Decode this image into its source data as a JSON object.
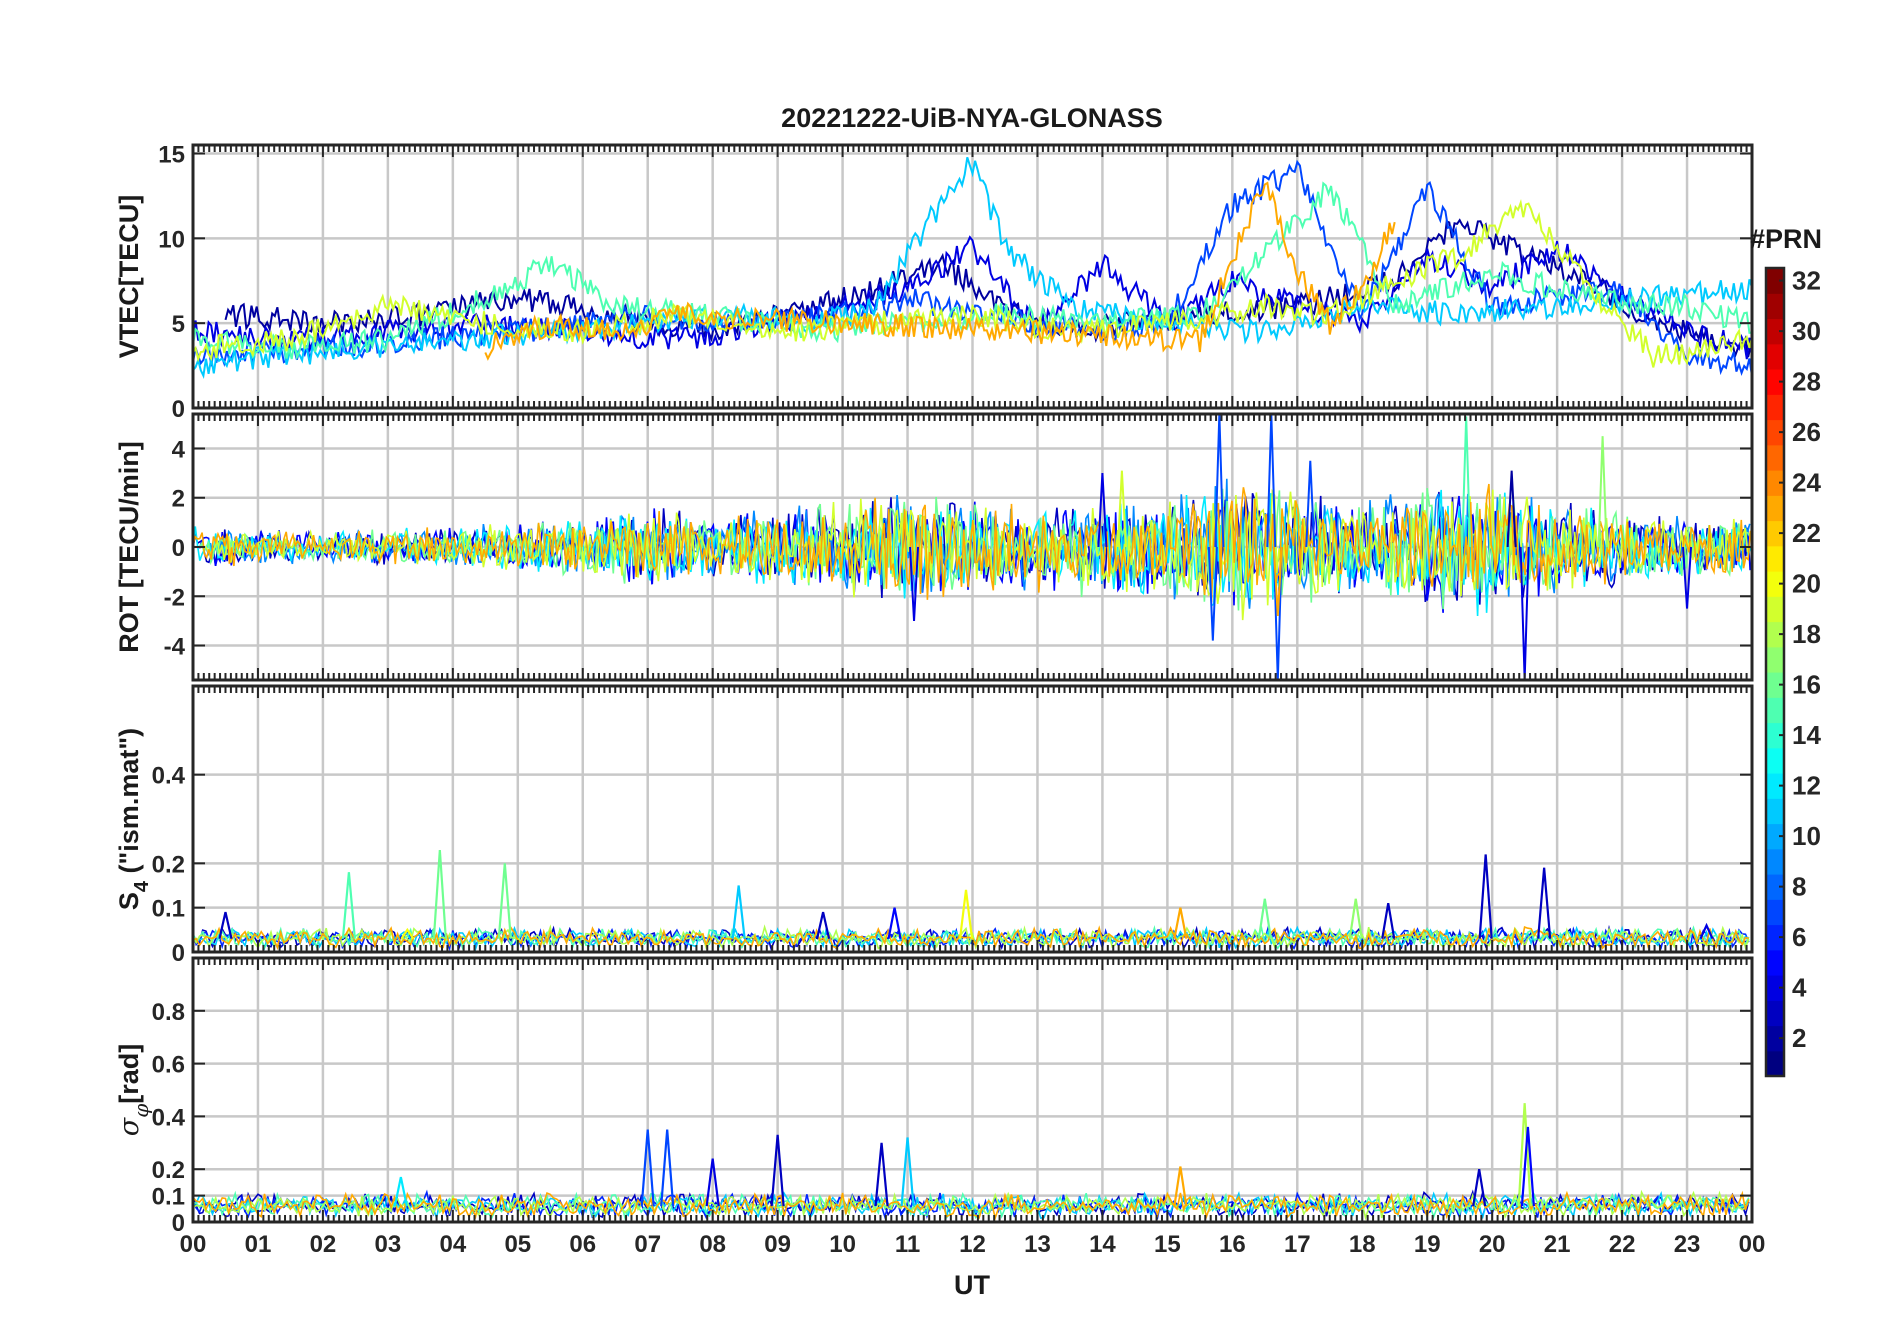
{
  "chart_data": {
    "type": "line",
    "title": "20221222-UiB-NYA-GLONASS",
    "xlabel": "UT",
    "x_range_hours": [
      0,
      24
    ],
    "x_tick_labels": [
      "00",
      "01",
      "02",
      "03",
      "04",
      "05",
      "06",
      "07",
      "08",
      "09",
      "10",
      "11",
      "12",
      "13",
      "14",
      "15",
      "16",
      "17",
      "18",
      "19",
      "20",
      "21",
      "22",
      "23",
      "00"
    ],
    "grid": true,
    "colorbar": {
      "title": "#PRN",
      "range": [
        1,
        32
      ],
      "tick_labels": [
        "2",
        "4",
        "6",
        "8",
        "10",
        "12",
        "14",
        "16",
        "18",
        "20",
        "22",
        "24",
        "26",
        "28",
        "30",
        "32"
      ],
      "colormap": "jet"
    },
    "panels": [
      {
        "id": "vtec",
        "ylabel": "VTEC[TECU]",
        "ylim": [
          0,
          15.5
        ],
        "y_ticks": [
          0,
          5,
          10,
          15
        ],
        "y_tick_labels": [
          "0",
          "5",
          "10",
          "15"
        ],
        "series": [
          {
            "prn": 2,
            "x": [
              0.5,
              2,
              3.5,
              5,
              6.5,
              8,
              9.5,
              10.5,
              11.5,
              12.5,
              13.5,
              14.5,
              15.5,
              17,
              18.5,
              19.5,
              20.5,
              21.5,
              22.5,
              24
            ],
            "values": [
              5.5,
              5.0,
              5.5,
              6.5,
              5.5,
              4.5,
              6.0,
              7.0,
              8.5,
              6.0,
              4.5,
              5.0,
              5.5,
              6.0,
              7.5,
              11.0,
              9.0,
              7.5,
              5.0,
              3.5
            ]
          },
          {
            "prn": 4,
            "x": [
              0,
              1.5,
              3,
              4.5,
              6,
              7.5,
              9,
              10,
              11,
              12,
              13,
              14,
              15,
              16,
              17,
              18,
              19,
              20,
              21,
              22,
              23,
              24
            ],
            "values": [
              4.5,
              4.0,
              4.5,
              5.0,
              4.5,
              4.0,
              5.0,
              6.0,
              7.0,
              9.5,
              4.5,
              8.5,
              5.0,
              7.5,
              6.0,
              5.0,
              9.0,
              7.0,
              9.5,
              6.5,
              4.5,
              3.5
            ]
          },
          {
            "prn": 7,
            "x": [
              0,
              2,
              3.5,
              5,
              6,
              7,
              8.5,
              10,
              11,
              12,
              13,
              14,
              15,
              16,
              17,
              18,
              19,
              20,
              21,
              22,
              23,
              24
            ],
            "values": [
              3.0,
              3.5,
              4.0,
              4.5,
              5.0,
              5.5,
              5.0,
              5.5,
              6.5,
              5.5,
              5.0,
              4.5,
              5.0,
              12.0,
              14.0,
              5.5,
              13.0,
              6.0,
              6.5,
              7.0,
              3.0,
              2.5
            ]
          },
          {
            "prn": 11,
            "x": [
              0,
              1,
              2.5,
              4,
              5.5,
              7,
              8.5,
              9.5,
              10.5,
              11.5,
              12,
              12.5,
              13.5,
              15,
              16.5,
              18,
              19.5,
              21,
              22.5,
              24
            ],
            "values": [
              2.5,
              3.0,
              3.5,
              4.0,
              4.5,
              5.0,
              5.5,
              5.0,
              6.0,
              12.0,
              14.5,
              9.5,
              6.0,
              5.0,
              4.5,
              6.0,
              5.5,
              6.0,
              6.5,
              7.0
            ]
          },
          {
            "prn": 15,
            "x": [
              0,
              1.5,
              3,
              4.5,
              5.5,
              6.5,
              8,
              9.5,
              11,
              12.5,
              14,
              15.5,
              16.5,
              17.5,
              18.5,
              20,
              21.5,
              23,
              24
            ],
            "values": [
              4.0,
              3.5,
              4.0,
              6.5,
              8.5,
              6.0,
              5.5,
              4.5,
              5.0,
              5.5,
              5.0,
              5.5,
              9.0,
              13.0,
              6.0,
              8.0,
              6.5,
              6.0,
              5.0
            ]
          },
          {
            "prn": 19,
            "x": [
              0,
              1.5,
              3,
              4.5,
              6,
              7.5,
              9,
              10.5,
              12,
              13.5,
              15,
              16.5,
              17.5,
              18.5,
              19.5,
              20.5,
              21.5,
              22.5,
              24
            ],
            "values": [
              3.5,
              4.0,
              6.0,
              5.0,
              4.5,
              5.5,
              4.5,
              5.0,
              5.5,
              4.5,
              5.0,
              6.0,
              5.5,
              7.5,
              9.0,
              12.0,
              7.0,
              3.0,
              4.0
            ]
          },
          {
            "prn": 23,
            "x": [
              4.5,
              5.5,
              6.5,
              7.5,
              15.5,
              16.5,
              17,
              17.5,
              18,
              18.5
            ],
            "values": [
              3.5,
              5.0,
              4.5,
              5.5,
              4.0,
              13.5,
              8.0,
              5.0,
              7.0,
              11.0
            ]
          }
        ]
      },
      {
        "id": "rot",
        "ylabel": "ROT [TECU/min]",
        "ylim": [
          -5.4,
          5.4
        ],
        "y_ticks": [
          -4,
          -2,
          0,
          2,
          4
        ],
        "y_tick_labels": [
          "-4",
          "-2",
          "0",
          "2",
          "4"
        ],
        "envelope": {
          "x": [
            0,
            1,
            2,
            3,
            4,
            5,
            6,
            7,
            8,
            9,
            10,
            11,
            12,
            13,
            14,
            15,
            16,
            17,
            18,
            19,
            20,
            21,
            22,
            23,
            24
          ],
          "values": [
            0.8,
            0.7,
            0.6,
            0.7,
            0.8,
            1.0,
            1.2,
            1.6,
            1.3,
            1.5,
            1.8,
            2.2,
            1.8,
            1.7,
            2.0,
            2.0,
            3.0,
            2.2,
            1.8,
            2.5,
            2.6,
            2.0,
            1.4,
            1.2,
            1.2
          ]
        },
        "spikes": [
          {
            "x": 11.1,
            "value": -3.0,
            "prn": 4
          },
          {
            "x": 14.0,
            "value": 3.0,
            "prn": 4
          },
          {
            "x": 14.3,
            "value": 3.1,
            "prn": 19
          },
          {
            "x": 15.8,
            "value": 5.4,
            "prn": 7
          },
          {
            "x": 15.7,
            "value": -3.8,
            "prn": 7
          },
          {
            "x": 16.6,
            "value": 5.4,
            "prn": 7
          },
          {
            "x": 16.7,
            "value": -5.4,
            "prn": 7
          },
          {
            "x": 17.2,
            "value": 3.5,
            "prn": 7
          },
          {
            "x": 19.6,
            "value": 5.3,
            "prn": 15
          },
          {
            "x": 20.3,
            "value": 3.1,
            "prn": 2
          },
          {
            "x": 20.5,
            "value": -5.4,
            "prn": 4
          },
          {
            "x": 21.7,
            "value": 4.5,
            "prn": 17
          },
          {
            "x": 23.0,
            "value": -2.5,
            "prn": 4
          },
          {
            "x": 16.7,
            "value": -2.8,
            "prn": 23
          }
        ]
      },
      {
        "id": "s4",
        "ylabel": "S4 (\"ism.mat\")",
        "ylim": [
          0,
          0.6
        ],
        "y_ticks": [
          0,
          0.1,
          0.2,
          0.4
        ],
        "y_tick_labels": [
          "0",
          "0.1",
          "0.2",
          "0.4"
        ],
        "baseline": 0.03,
        "spikes": [
          {
            "x": 0.5,
            "value": 0.09,
            "prn": 3
          },
          {
            "x": 2.4,
            "value": 0.18,
            "prn": 15
          },
          {
            "x": 3.3,
            "value": 0.05,
            "prn": 20
          },
          {
            "x": 3.8,
            "value": 0.23,
            "prn": 16
          },
          {
            "x": 4.8,
            "value": 0.2,
            "prn": 16
          },
          {
            "x": 8.4,
            "value": 0.15,
            "prn": 11
          },
          {
            "x": 9.7,
            "value": 0.09,
            "prn": 3
          },
          {
            "x": 10.8,
            "value": 0.1,
            "prn": 5
          },
          {
            "x": 11.9,
            "value": 0.14,
            "prn": 20
          },
          {
            "x": 15.2,
            "value": 0.1,
            "prn": 23
          },
          {
            "x": 16.5,
            "value": 0.12,
            "prn": 16
          },
          {
            "x": 17.9,
            "value": 0.12,
            "prn": 17
          },
          {
            "x": 18.4,
            "value": 0.11,
            "prn": 3
          },
          {
            "x": 19.9,
            "value": 0.22,
            "prn": 3
          },
          {
            "x": 20.8,
            "value": 0.19,
            "prn": 3
          },
          {
            "x": 23.3,
            "value": 0.06,
            "prn": 4
          }
        ]
      },
      {
        "id": "sigma",
        "ylabel": "σφ[rad]",
        "ylim": [
          0,
          1
        ],
        "y_ticks": [
          0,
          0.1,
          0.2,
          0.4,
          0.6,
          0.8
        ],
        "y_tick_labels": [
          "0",
          "0.1",
          "0.2",
          "0.4",
          "0.6",
          "0.8"
        ],
        "baseline": 0.06,
        "spikes": [
          {
            "x": 7.0,
            "value": 0.35,
            "prn": 7
          },
          {
            "x": 7.3,
            "value": 0.35,
            "prn": 7
          },
          {
            "x": 9.0,
            "value": 0.33,
            "prn": 3
          },
          {
            "x": 10.6,
            "value": 0.3,
            "prn": 3
          },
          {
            "x": 11.0,
            "value": 0.32,
            "prn": 11
          },
          {
            "x": 8.0,
            "value": 0.24,
            "prn": 4
          },
          {
            "x": 15.2,
            "value": 0.21,
            "prn": 23
          },
          {
            "x": 20.5,
            "value": 0.45,
            "prn": 18
          },
          {
            "x": 20.55,
            "value": 0.36,
            "prn": 5
          },
          {
            "x": 3.2,
            "value": 0.17,
            "prn": 12
          },
          {
            "x": 19.8,
            "value": 0.2,
            "prn": 3
          }
        ]
      }
    ]
  }
}
